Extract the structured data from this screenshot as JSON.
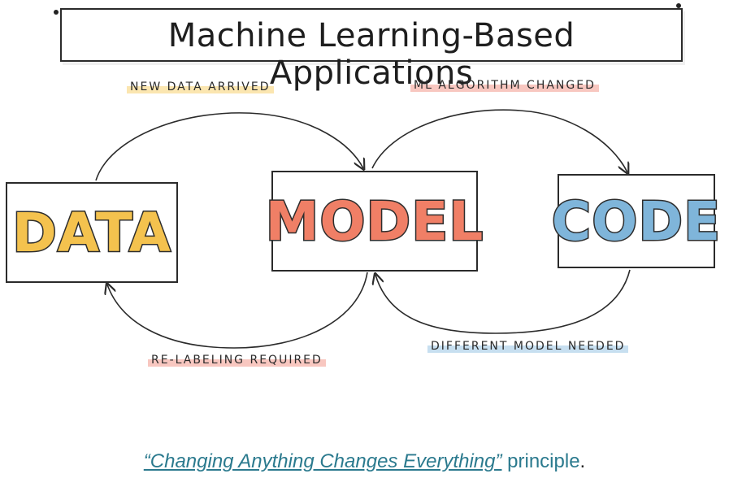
{
  "title": "Machine Learning-Based Applications",
  "boxes": {
    "data": {
      "label": "DATA",
      "fill": "#F4C24E"
    },
    "model": {
      "label": "MODEL",
      "fill": "#F07F66"
    },
    "code": {
      "label": "CODE",
      "fill": "#7FB5DA"
    }
  },
  "edges": {
    "new_data_arrived": {
      "label": "NEW DATA ARRIVED",
      "highlight": "#FADE96"
    },
    "ml_algorithm_changed": {
      "label": "ML ALGORITHM CHANGED",
      "highlight": "#F5AFA5"
    },
    "different_model_needed": {
      "label": "DIFFERENT MODEL NEEDED",
      "highlight": "#B4D4EB"
    },
    "re_labeling_required": {
      "label": "RE-LABELING REQUIRED",
      "highlight": "#F5AFA5"
    }
  },
  "caption": {
    "quote": "“Changing Anything Changes Everything”",
    "word": "principle",
    "period": "."
  },
  "colors": {
    "ink": "#2B2B2B",
    "caption_link": "#2B7A8E"
  }
}
